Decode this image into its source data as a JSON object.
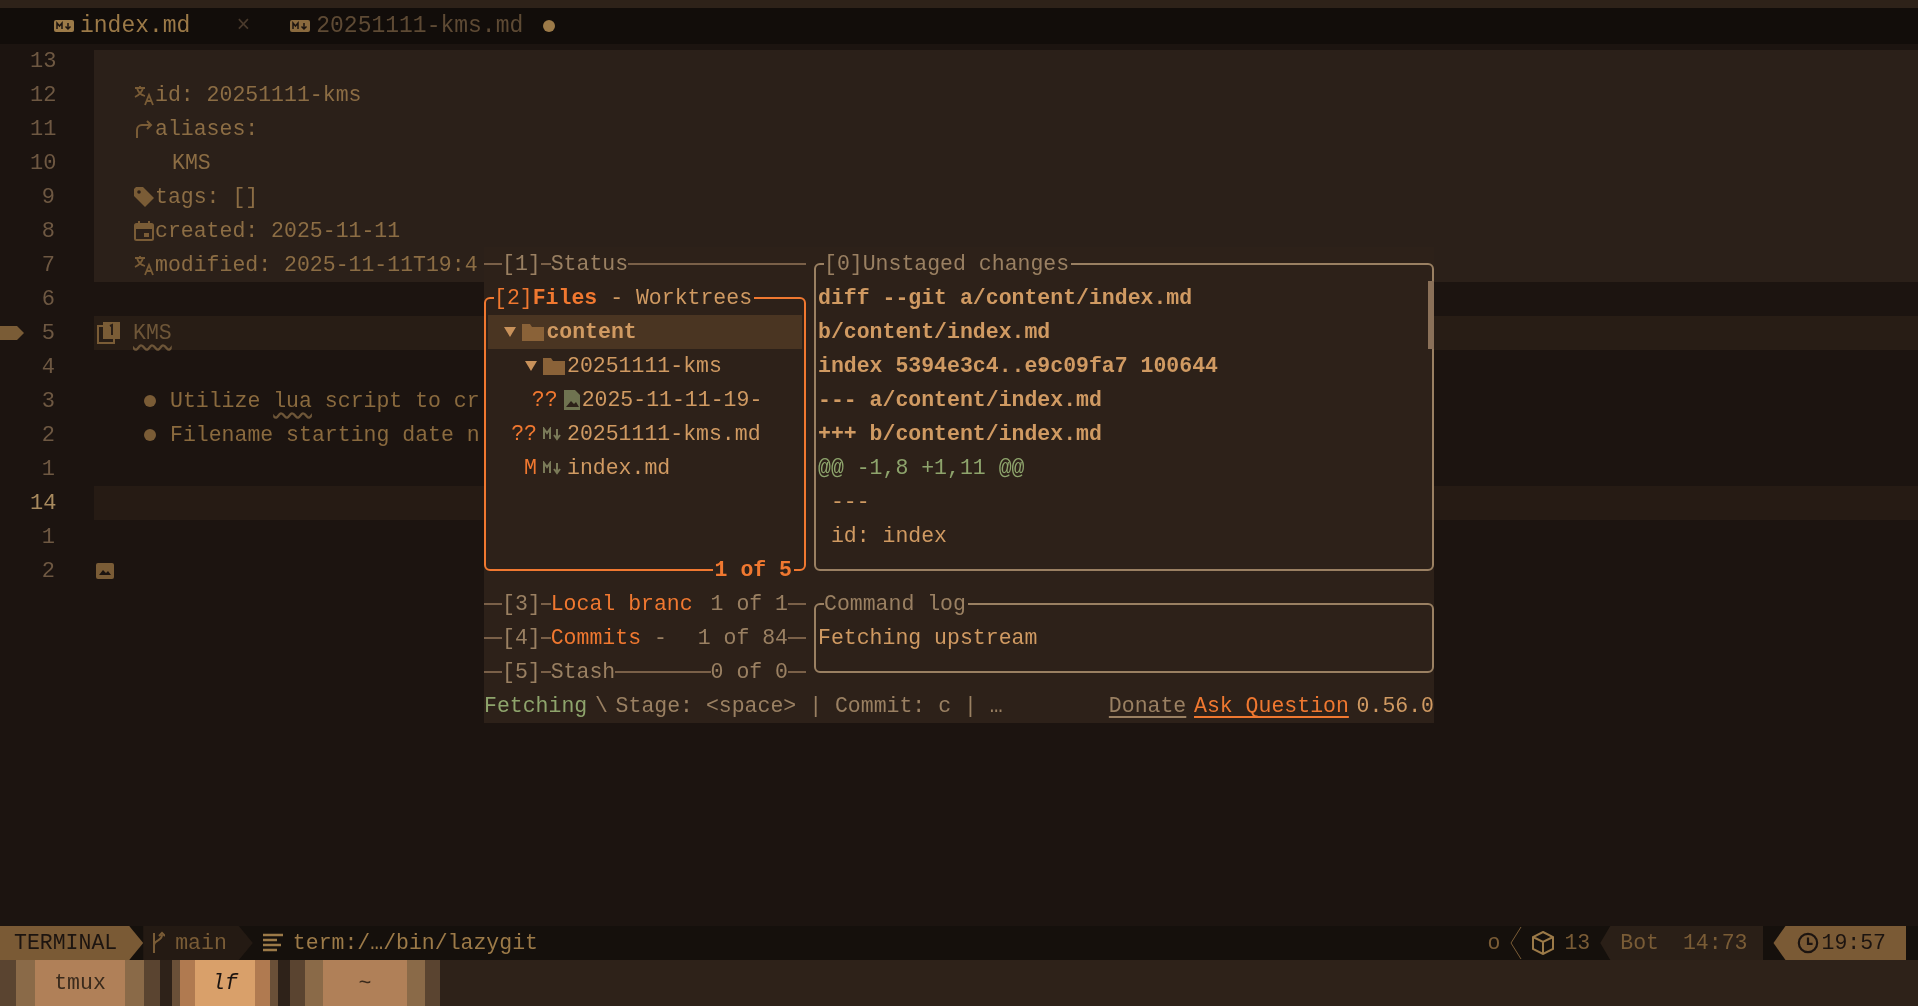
{
  "tabs": [
    {
      "label": "index.md",
      "selected": true,
      "close": "×",
      "modified": false
    },
    {
      "label": "20251111-kms.md",
      "selected": false,
      "modified": true
    }
  ],
  "editor": {
    "lines": [
      {
        "number": "13",
        "kind": "pad",
        "current": false
      },
      {
        "number": "12",
        "kind": "language",
        "text": "id: 20251111-kms",
        "current": false
      },
      {
        "number": "11",
        "kind": "alias",
        "text": "aliases:",
        "current": false
      },
      {
        "number": "10",
        "kind": "value",
        "text": "KMS",
        "current": false
      },
      {
        "number": "9",
        "kind": "tag",
        "text": "tags: []",
        "current": false
      },
      {
        "number": "8",
        "kind": "calendar",
        "text": "created: 2025-11-11",
        "current": false
      },
      {
        "number": "7",
        "kind": "language",
        "text": "modified: 2025-11-11T19:4",
        "current": false
      },
      {
        "number": "6",
        "kind": "blank",
        "current": false
      },
      {
        "number": "5",
        "kind": "heading",
        "sign": true,
        "segments": [
          {
            "text": "KMS",
            "misspelled": true
          }
        ],
        "current": false
      },
      {
        "number": "4",
        "kind": "blank",
        "current": false
      },
      {
        "number": "3",
        "kind": "bullet",
        "segments": [
          {
            "text": "Utilize ",
            "misspelled": false
          },
          {
            "text": "lua",
            "misspelled": true
          },
          {
            "text": " script to cr",
            "misspelled": false
          }
        ],
        "current": false
      },
      {
        "number": "2",
        "kind": "bullet",
        "segments": [
          {
            "text": "Filename starting date n",
            "misspelled": false
          }
        ],
        "current": false
      },
      {
        "number": "1",
        "kind": "blank",
        "current": false
      },
      {
        "number": "14",
        "kind": "blank",
        "current": true
      },
      {
        "number": "1",
        "kind": "blank",
        "current": false
      },
      {
        "number": "2",
        "kind": "image",
        "current": false
      }
    ]
  },
  "lazygit": {
    "status": {
      "number": "[1]",
      "title": "Status",
      "highlighted": false
    },
    "files": {
      "number": "[2]",
      "title": "Files",
      "rest": " - Worktrees",
      "footer": "1 of 5",
      "tree": [
        {
          "name": "content",
          "kind": "folder",
          "expanded": true,
          "selected": true,
          "children": [
            {
              "name": "20251111-kms",
              "kind": "folder",
              "expanded": true,
              "selected": false,
              "children": [
                {
                  "name": "2025-11-11-19-",
                  "kind": "image",
                  "status": "??",
                  "selected": false
                }
              ]
            },
            {
              "name": "20251111-kms.md",
              "kind": "markdown",
              "status": "??",
              "selected": false
            },
            {
              "name": "index.md",
              "kind": "markdown",
              "status": "M",
              "selected": false
            }
          ]
        }
      ]
    },
    "collapsed": [
      {
        "number": "[3]",
        "title": "Local branc",
        "footer": "1 of 1",
        "highlighted": true,
        "line": false
      },
      {
        "number": "[4]",
        "title": "Commits",
        "rest": " - ",
        "footer": "1 of 84",
        "highlighted": true,
        "line": false
      },
      {
        "number": "[5]",
        "title": "Stash",
        "footer": "0 of 0",
        "highlighted": false,
        "line": true
      }
    ],
    "diff": {
      "number": "[0]",
      "title": "Unstaged changes",
      "lines": [
        {
          "kind": "header",
          "text": "diff --git a/content/index.md"
        },
        {
          "kind": "header",
          "text": "b/content/index.md"
        },
        {
          "kind": "header",
          "text": "index 5394e3c4..e9c09fa7 100644"
        },
        {
          "kind": "header",
          "text": "--- a/content/index.md"
        },
        {
          "kind": "header",
          "text": "+++ b/content/index.md"
        },
        {
          "kind": "hunk",
          "text": "@@ -1,8 +1,11 @@"
        },
        {
          "kind": "context",
          "text": " ---"
        },
        {
          "kind": "context",
          "text": " id: index"
        }
      ]
    },
    "command_log": {
      "title": "Command log",
      "lines": [
        "Fetching upstream"
      ]
    },
    "bottom": {
      "activity": "Fetching",
      "spinner": "\\",
      "hints": "Stage: <space> | Commit: c | …",
      "links": [
        {
          "label": "Donate",
          "kind": "plain"
        },
        {
          "label": "Ask Question",
          "kind": "accent"
        }
      ],
      "version": "0.56.0"
    }
  },
  "statusline": {
    "mode": "TERMINAL",
    "branch": "main",
    "file": "term:/…/bin/lazygit",
    "encoding": "o",
    "count": "13",
    "position": "Bot",
    "cursor": "14:73",
    "time": "19:57"
  },
  "tmux": [
    {
      "name": "tmux",
      "selected": false
    },
    {
      "name": "lf",
      "selected": true
    },
    {
      "name": "~",
      "selected": false
    }
  ]
}
